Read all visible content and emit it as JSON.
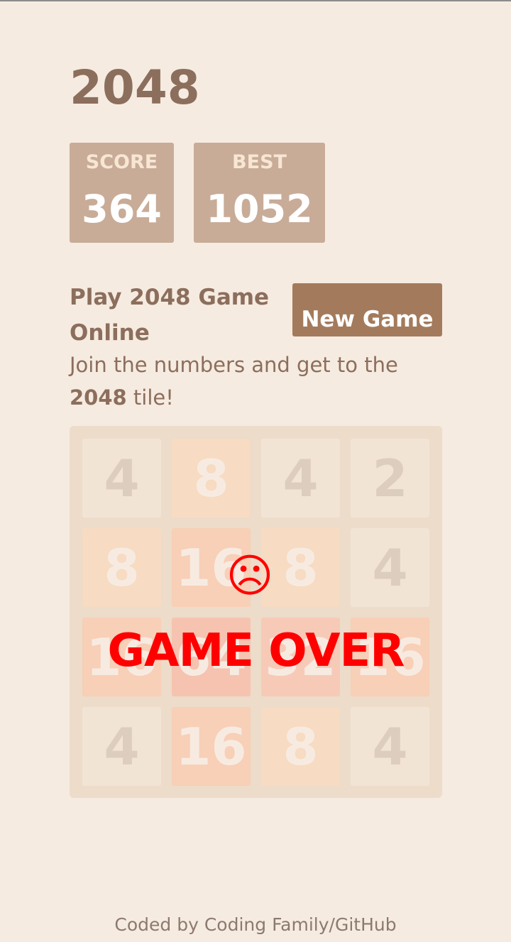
{
  "header": {
    "title": "2048"
  },
  "scores": {
    "score_label": "SCORE",
    "score_value": "364",
    "best_label": "BEST",
    "best_value": "1052"
  },
  "intro": {
    "heading": "Play 2048 Game Online",
    "new_game_label": "New Game",
    "text_before": "Join the numbers and get to the ",
    "text_bold": "2048",
    "text_after": " tile!"
  },
  "board": {
    "rows": [
      [
        "4",
        "8",
        "4",
        "2"
      ],
      [
        "8",
        "16",
        "8",
        "4"
      ],
      [
        "16",
        "64",
        "32",
        "16"
      ],
      [
        "4",
        "16",
        "8",
        "4"
      ]
    ]
  },
  "overlay": {
    "face": "☹",
    "message": "GAME OVER"
  },
  "footer": {
    "text": "Coded by Coding Family/GitHub"
  },
  "colors": {
    "background": "#f6ebe0",
    "board": "#ecdcc9",
    "tile_2": "#f2e4d5",
    "tile_4": "#f2e4d5",
    "tile_8": "#f7dbc2",
    "tile_16": "#f8cfb7",
    "tile_32": "#f7cab8",
    "tile_64": "#f6c3b1",
    "text_dark": "#ddcdbf",
    "text_light": "#f7ebe1",
    "game_over": "#ff0000"
  }
}
